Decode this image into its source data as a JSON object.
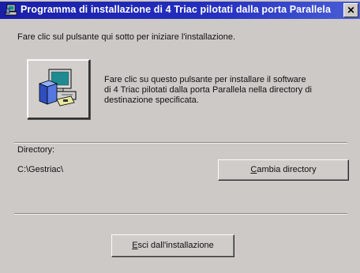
{
  "window": {
    "title": "Programma di installazione di 4 Triac pilotati dalla  porta Parallela",
    "close_label": "✕"
  },
  "intro_text": "Fare clic sul pulsante qui sotto per iniziare l'installazione.",
  "install": {
    "description_lines": [
      "Fare clic su questo pulsante per installare il software",
      "di 4 Triac pilotati dalla porta Parallela nella directory di",
      "destinazione specificata."
    ]
  },
  "directory": {
    "label": "Directory:",
    "value": "C:\\Gestriac\\",
    "change_button": {
      "accel": "C",
      "rest": "ambia directory"
    }
  },
  "exit_button": {
    "accel": "E",
    "rest": "sci dall'installazione"
  }
}
